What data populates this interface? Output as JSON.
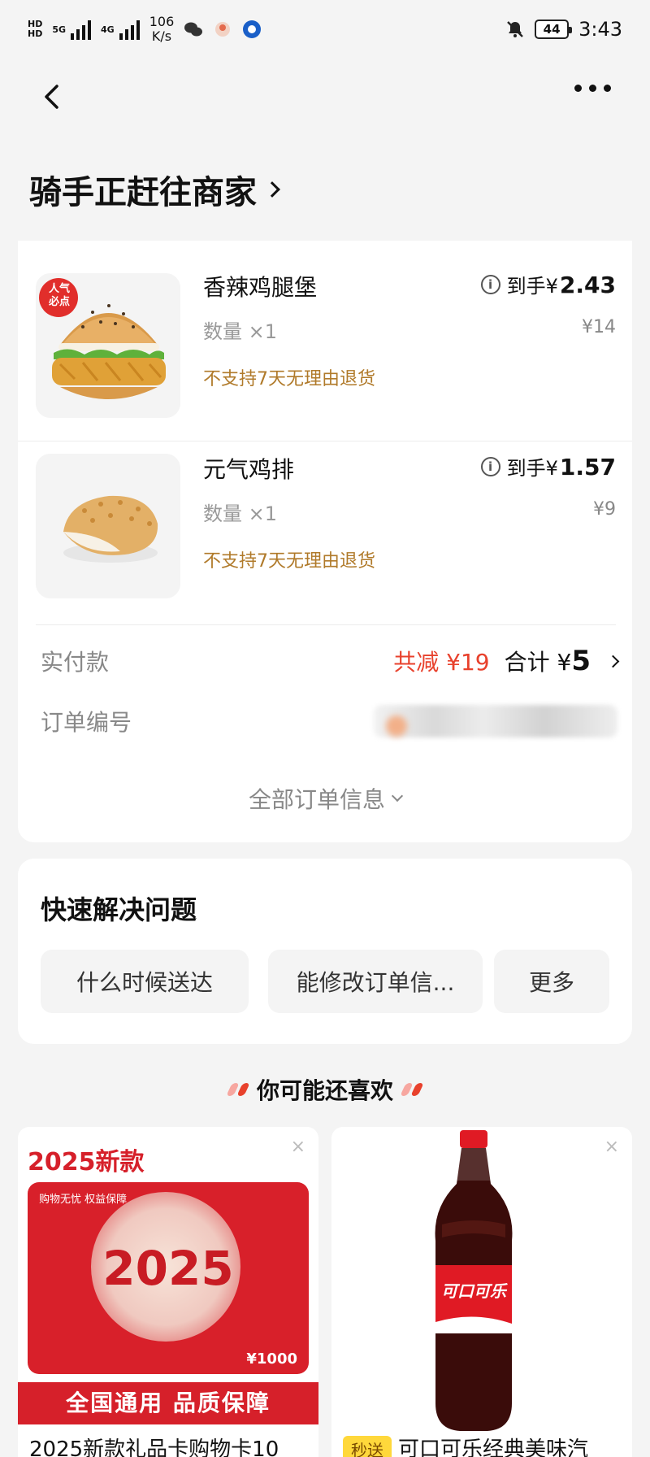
{
  "statusbar": {
    "network_type": "5G",
    "network_type2": "4G",
    "speed_value": "106",
    "speed_unit": "K/s",
    "battery": "44",
    "time": "3:43"
  },
  "order": {
    "status_title": "骑手正赶往商家",
    "items": [
      {
        "name": "香辣鸡腿堡",
        "qty": "数量 ×1",
        "policy": "不支持7天无理由退货",
        "price_label": "到手¥",
        "price": "2.43",
        "original": "¥14",
        "badge": "人气必点"
      },
      {
        "name": "元气鸡排",
        "qty": "数量 ×1",
        "policy": "不支持7天无理由退货",
        "price_label": "到手¥",
        "price": "1.57",
        "original": "¥9"
      }
    ],
    "paid_label": "实付款",
    "discount": "共减 ¥19",
    "total_label": "合计 ¥",
    "total_value": "5",
    "order_no_label": "订单编号",
    "expand_label": "全部订单信息"
  },
  "quick": {
    "title": "快速解决问题",
    "chips": [
      "什么时候送达",
      "能修改订单信...",
      "更多"
    ]
  },
  "recommend": {
    "heading": "你可能还喜欢",
    "cards": [
      {
        "top_label": "2025新款",
        "card_tag": "购物无忧 权益保障",
        "year": "2025",
        "value": "¥1000",
        "band": "全国通用 品质保障",
        "title": "2025新款礼品卡购物卡10"
      },
      {
        "badge": "秒送",
        "title": "可口可乐经典美味汽",
        "bottle_logo": "可口可乐"
      }
    ]
  },
  "colors": {
    "accent_red": "#e8412c",
    "policy_brown": "#b07a2a",
    "page_bg": "#f4f4f4"
  }
}
